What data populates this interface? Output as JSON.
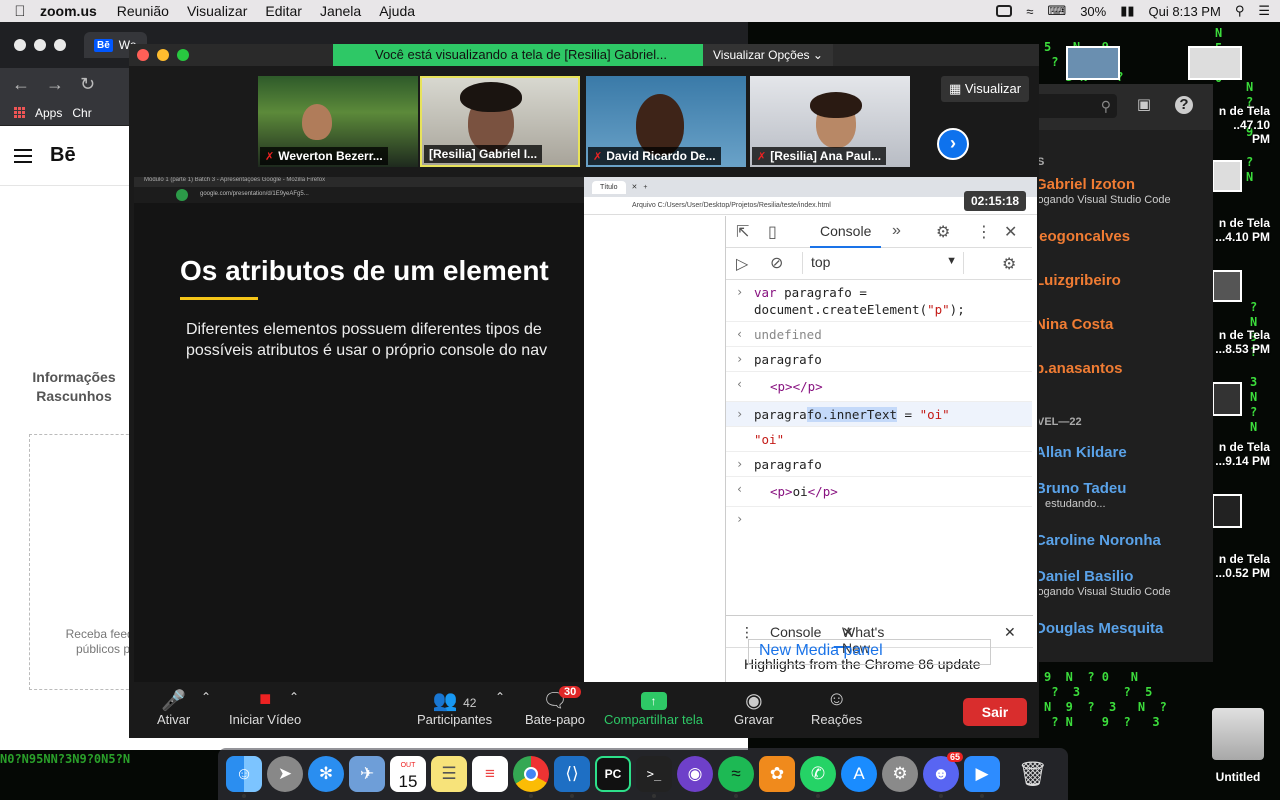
{
  "menubar": {
    "app_name": "zoom.us",
    "menus": [
      "Reunião",
      "Visualizar",
      "Editar",
      "Janela",
      "Ajuda"
    ],
    "battery": "30%",
    "clock": "Qui 8:13 PM"
  },
  "chrome_bg": {
    "tab_label": "We",
    "bookmarks": [
      "Apps",
      "Chr"
    ],
    "brand": "Bē",
    "sidebar_text": "Informações Rascunhos",
    "box_text": "Receba feedb públicos p"
  },
  "zoom": {
    "notice": "Você está visualizando a tela de [Resilia] Gabriel...",
    "view_options": "Visualizar Opções",
    "view_button": "Visualizar",
    "participants": [
      {
        "name": "Weverton Bezerr...",
        "muted": true
      },
      {
        "name": "[Resilia] Gabriel I...",
        "muted": false
      },
      {
        "name": "David Ricardo De...",
        "muted": true
      },
      {
        "name": "[Resilia] Ana Paul...",
        "muted": true
      }
    ],
    "timer": "02:15:18",
    "toolbar": {
      "mute": "Ativar",
      "video": "Iniciar Vídeo",
      "participants": "Participantes",
      "participants_count": "42",
      "chat": "Bate-papo",
      "chat_badge": "30",
      "share": "Compartilhar tela",
      "record": "Gravar",
      "reactions": "Reações",
      "leave": "Sair"
    }
  },
  "slide": {
    "window_title": "Módulo 1 (parte 1) Batch 3 - Apresentações Google - Mozilla Firefox",
    "url": "google.com/presentation/d/1E9yeAFg5...",
    "heading": "Os atributos de um element",
    "body_line1": "Diferentes elementos possuem diferentes tipos de",
    "body_line2": "possíveis atributos é usar o próprio console do nav"
  },
  "devtools": {
    "tab_title": "Título",
    "address": "Arquivo   C:/Users/User/Desktop/Projetos/Resilia/teste/index.html",
    "console_tab": "Console",
    "context": "top",
    "lines": [
      {
        "kind": "in",
        "a": "var",
        "b": " paragrafo =",
        "c": "document.createElement(",
        "d": "\"p\"",
        "e": ");"
      },
      {
        "kind": "out",
        "text": "undefined"
      },
      {
        "kind": "in",
        "text": "paragrafo"
      },
      {
        "kind": "out",
        "text": "<p></p>"
      },
      {
        "kind": "in",
        "pre": "paragra",
        "sel": "fo.innerText",
        "post": " = ",
        "str": "\"oi\""
      },
      {
        "kind": "out",
        "text": "\"oi\""
      },
      {
        "kind": "in",
        "text": "paragrafo"
      },
      {
        "kind": "out",
        "open": "<p>",
        "mid": "oi",
        "close": "</p>"
      }
    ],
    "drawer_console": "Console",
    "drawer_whatsnew": "What's New",
    "highlights": "Highlights from the Chrome 86 update",
    "media_panel": "New Media panel"
  },
  "gallery": {
    "section_1": "S",
    "section_2": "VEL—22",
    "people": [
      {
        "name": "Gabriel Izoton",
        "sub": "jogando Visual Studio Code"
      },
      {
        "name": "leogoncalves",
        "sub": ""
      },
      {
        "name": "Luizgribeiro",
        "sub": ""
      },
      {
        "name": "Nina Costa",
        "sub": ""
      },
      {
        "name": "p.anasantos",
        "sub": ""
      },
      {
        "name": "Allan Kildare",
        "sub": ""
      },
      {
        "name": "Bruno Tadeu",
        "sub": "estudando..."
      },
      {
        "name": "Caroline Noronha",
        "sub": ""
      },
      {
        "name": "Daniel Basilio",
        "sub": "jogando Visual Studio Code"
      },
      {
        "name": "Douglas Mesquita",
        "sub": ""
      }
    ]
  },
  "desktop": {
    "shots": [
      {
        "l1": "n de Tela",
        "l2": "..47.10 PM"
      },
      {
        "l1": "n de Tela",
        "l2": "...4.10 PM"
      },
      {
        "l1": "n de Tela",
        "l2": "...8.53 PM"
      },
      {
        "l1": "n de Tela",
        "l2": "...9.14 PM"
      },
      {
        "l1": "n de Tela",
        "l2": "...0.52 PM"
      }
    ],
    "disk_label": "Untitled",
    "calendar_month": "OUT",
    "calendar_day": "15",
    "discord_badge": "65"
  },
  "colors": {
    "zoom_green": "#2ec866",
    "zoom_blue": "#0e72ed",
    "leave_red": "#d92d2d",
    "gallery_orange": "#f07c33",
    "gallery_blue": "#5aa2e8"
  }
}
